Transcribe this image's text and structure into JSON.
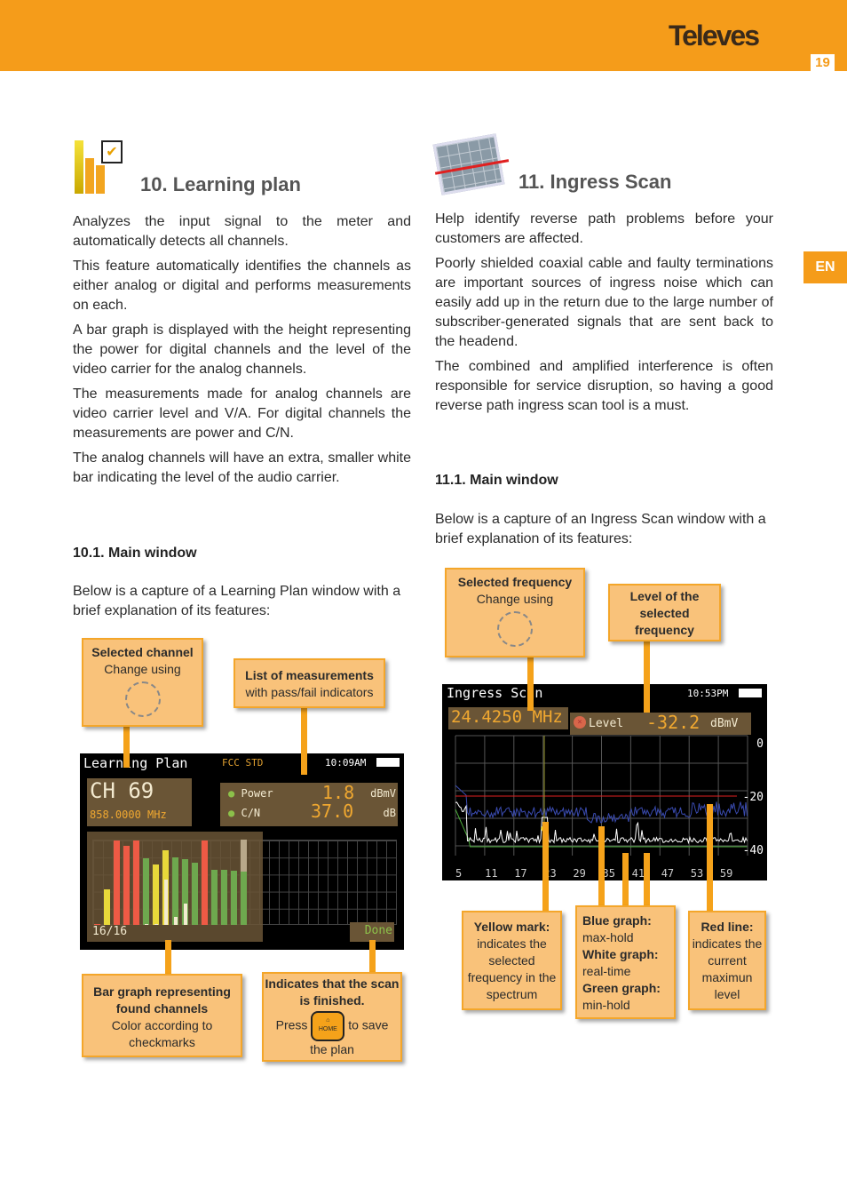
{
  "header": {
    "brand": "Televes",
    "page_number": "19",
    "lang_tab": "EN"
  },
  "left": {
    "title": "10. Learning plan",
    "paragraphs": [
      "Analyzes the input signal to the meter and automatically detects all channels.",
      "This feature automatically identifies the channels as either analog or digital and performs measurements on each.",
      "A bar graph is displayed with the height representing the power for digital channels and the level of the video carrier for the analog channels.",
      "The measurements made for analog channels are video carrier level and V/A. For digital channels the measurements are power and C/N.",
      "The analog channels will have an extra, smaller white bar indicating the level of the audio carrier."
    ],
    "subtitle": "10.1. Main window",
    "intro": "Below is a capture of a Learning Plan window with a brief explanation of its features:",
    "screen": {
      "title": "Learning Plan",
      "standard": "FCC STD",
      "time": "10:09AM",
      "channel": "CH 69",
      "frequency": "858.0000 MHz",
      "measurements": [
        {
          "label": "Power",
          "value": "1.8",
          "unit": "dBmV",
          "status": "pass"
        },
        {
          "label": "C/N",
          "value": "37.0",
          "unit": "dB",
          "status": "pass"
        }
      ],
      "count": "16/16",
      "done": "Done",
      "bars": [
        {
          "color": "red",
          "level": 0.01
        },
        {
          "color": "yellow",
          "level": 0.42
        },
        {
          "color": "red",
          "level": 0.99
        },
        {
          "color": "red",
          "level": 0.93
        },
        {
          "color": "red",
          "level": 0.99
        },
        {
          "color": "green",
          "level": 0.78,
          "audio": 0.01
        },
        {
          "color": "yellow",
          "level": 0.71,
          "audio": 0.01
        },
        {
          "color": "yellow",
          "level": 0.87,
          "audio": 0.53
        },
        {
          "color": "green",
          "level": 0.79,
          "audio": 0.09
        },
        {
          "color": "green",
          "level": 0.77,
          "audio": 0.25
        },
        {
          "color": "green",
          "level": 0.73
        },
        {
          "color": "red",
          "level": 0.99
        },
        {
          "color": "green",
          "level": 0.65
        },
        {
          "color": "green",
          "level": 0.65
        },
        {
          "color": "green",
          "level": 0.64
        },
        {
          "color": "green",
          "level": 0.63,
          "max": 1.0
        }
      ]
    },
    "callouts": {
      "channel": {
        "title": "Selected channel",
        "text": "Change using"
      },
      "measurements": {
        "title": "List of measurements",
        "text": "with pass/fail indicators"
      },
      "bars": {
        "title": "Bar graph representing found channels",
        "text": "Color according to checkmarks"
      },
      "done": {
        "title": "Indicates that the scan is finished.",
        "press": "Press",
        "key": "HOME",
        "after": "to save",
        "end": "the plan"
      }
    }
  },
  "right": {
    "title": "11. Ingress Scan",
    "paragraphs": [
      "Help identify reverse path problems before your customers are affected.",
      "Poorly shielded coaxial cable and faulty terminations are important sources of ingress noise which can easily add up in the return due to the large number of subscriber-generated signals that are sent back to the headend.",
      "The combined and amplified interference is often responsible for service disruption, so having a good reverse path ingress scan tool is a must."
    ],
    "subtitle": "11.1. Main window",
    "intro": "Below is a capture of an Ingress Scan window with a brief explanation of its features:",
    "screen": {
      "title": "Ingress Scan",
      "time": "10:53PM",
      "frequency": "24.4250 MHz",
      "level_label": "Level",
      "level_value": "-32.2",
      "level_unit": "dBmV",
      "level_status": "fail",
      "y_ticks": [
        "0",
        "-20",
        "-40"
      ],
      "x_ticks": [
        "5",
        "11",
        "17",
        "23",
        "29",
        "35",
        "41",
        "47",
        "53",
        "59"
      ],
      "red_line_dBmV": -20
    },
    "callouts": {
      "freq": {
        "title": "Selected frequency",
        "text": "Change using"
      },
      "level": {
        "title": "Level of the selected frequency"
      },
      "yellow": {
        "title": "Yellow mark:",
        "text": "indicates the selected frequency in the spectrum"
      },
      "graphs": {
        "blue": "Blue graph:",
        "blue_t": "max-hold",
        "white": "White graph:",
        "white_t": "real-time",
        "green": "Green graph:",
        "green_t": "min-hold"
      },
      "red": {
        "title": "Red line:",
        "text": "indicates the current maximun level"
      }
    }
  },
  "colors": {
    "accent": "#f59c1a",
    "callout": "#f9c27a",
    "bar_red": "#ee5a45",
    "bar_yellow": "#e8d83a",
    "bar_green": "#6ea84e",
    "blue_graph": "#3a4bb0",
    "red_line": "#e02020"
  }
}
